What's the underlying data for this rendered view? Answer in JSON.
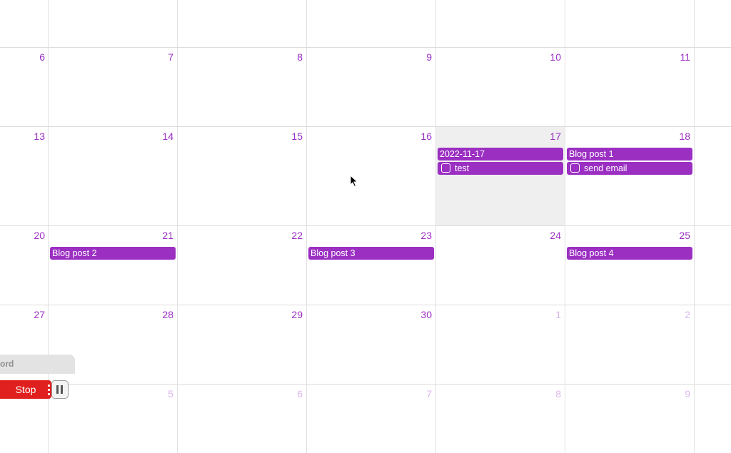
{
  "calendar": {
    "accent_color": "#9b2fc2",
    "today_background": "#efefef",
    "days": {
      "r1": [
        "6",
        "7",
        "8",
        "9",
        "10",
        "11"
      ],
      "r2": [
        "13",
        "14",
        "15",
        "16",
        "17",
        "18"
      ],
      "r3": [
        "20",
        "21",
        "22",
        "23",
        "24",
        "25"
      ],
      "r4": [
        "27",
        "28",
        "29",
        "30",
        "1",
        "2"
      ],
      "r5": [
        "5",
        "6",
        "7",
        "8",
        "9"
      ]
    },
    "events": {
      "d17_all_day": "2022-11-17",
      "d17_task": "test",
      "d18_all_day": "Blog post 1",
      "d18_task": "send email",
      "d21": "Blog post 2",
      "d23": "Blog post 3",
      "d25": "Blog post 4"
    }
  },
  "recorder": {
    "label": "ord",
    "stop_label": "Stop",
    "stop_color": "#e0201e",
    "pause_icon": "pause-icon"
  }
}
